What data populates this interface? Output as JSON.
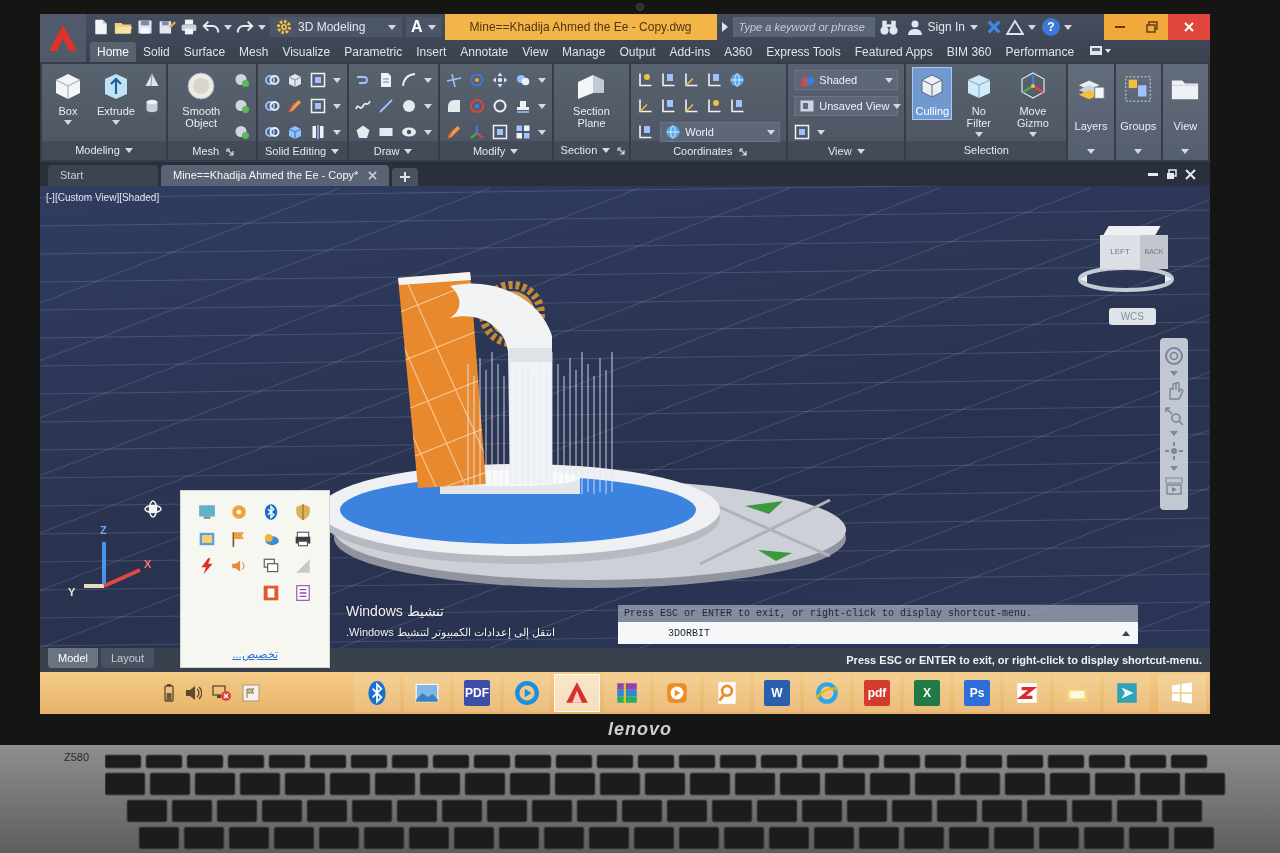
{
  "title_bar": {
    "workspace": "3D Modeling",
    "letter_button": "A",
    "title": "Mine==Khadija Ahmed the Ee - Copy.dwg",
    "search": {
      "placeholder": "Type a keyword or phrase"
    },
    "sign_in": "Sign In",
    "help": "?"
  },
  "ribbon_tabs": [
    {
      "label": "Home",
      "selected": true
    },
    {
      "label": "Solid",
      "selected": false
    },
    {
      "label": "Surface",
      "selected": false
    },
    {
      "label": "Mesh",
      "selected": false
    },
    {
      "label": "Visualize",
      "selected": false
    },
    {
      "label": "Parametric",
      "selected": false
    },
    {
      "label": "Insert",
      "selected": false
    },
    {
      "label": "Annotate",
      "selected": false
    },
    {
      "label": "View",
      "selected": false
    },
    {
      "label": "Manage",
      "selected": false
    },
    {
      "label": "Output",
      "selected": false
    },
    {
      "label": "Add-ins",
      "selected": false
    },
    {
      "label": "A360",
      "selected": false
    },
    {
      "label": "Express Tools",
      "selected": false
    },
    {
      "label": "Featured Apps",
      "selected": false
    },
    {
      "label": "BIM 360",
      "selected": false
    },
    {
      "label": "Performance",
      "selected": false
    }
  ],
  "ribbon_panels": [
    {
      "kind": "modeling",
      "title": "Modeling",
      "buttons": [
        {
          "label": "Box",
          "on": false
        },
        {
          "label": "Extrude",
          "on": false
        }
      ]
    },
    {
      "kind": "mesh",
      "title": "Mesh",
      "buttons": [
        {
          "label": "Smooth Object",
          "on": false
        }
      ]
    },
    {
      "kind": "solidedit",
      "title": "Solid Editing"
    },
    {
      "kind": "draw",
      "title": "Draw"
    },
    {
      "kind": "modify",
      "title": "Modify"
    },
    {
      "kind": "section",
      "title": "Section",
      "buttons": [
        {
          "label": "Section Plane",
          "on": false
        }
      ]
    },
    {
      "kind": "coordinates",
      "title": "Coordinates",
      "dropdowns": [
        "World"
      ]
    },
    {
      "kind": "view",
      "title": "View",
      "dropdowns": [
        "Shaded",
        "Unsaved View"
      ]
    },
    {
      "kind": "selection",
      "title": "Selection",
      "buttons": [
        {
          "label": "Culling",
          "on": true
        },
        {
          "label": "No Filter",
          "on": false
        },
        {
          "label": "Move Gizmo",
          "on": false
        }
      ]
    },
    {
      "kind": "collapsed",
      "title": "Layers"
    },
    {
      "kind": "collapsed",
      "title": "Groups"
    },
    {
      "kind": "collapsed",
      "title": "View"
    }
  ],
  "file_tabs": [
    {
      "label": "Start",
      "selected": false
    },
    {
      "label": "Mine==Khadija Ahmed the Ee - Copy*",
      "selected": true
    }
  ],
  "viewport": {
    "label": "[-][Custom View][Shaded]",
    "viewcube_faces": [
      "LEFT",
      "BACK"
    ],
    "ucs_menu": "WCS",
    "ucs_axes": [
      "Z",
      "Y",
      "X"
    ]
  },
  "command_line": {
    "history": "Press ESC or ENTER to exit, or right-click to display shortcut-menu.",
    "input": "3DORBIT"
  },
  "layout_tabs": [
    {
      "label": "Model",
      "selected": true
    },
    {
      "label": "Layout",
      "selected": false
    }
  ],
  "status_prompt": "Press ESC or ENTER to exit, or right-click to display shortcut-menu.",
  "activation_watermark": {
    "title": "تنشيط Windows",
    "message": "انتقل إلى إعدادات الكمبيوتر لتنشيط Windows."
  },
  "tray_popup": {
    "link": "تخصيص..."
  },
  "taskbar": {
    "apps": [
      {
        "kind": "bluetooth",
        "active": false
      },
      {
        "kind": "photo",
        "active": false
      },
      {
        "kind": "tile",
        "label": "PDF",
        "color": "#3b4fa8",
        "active": false
      },
      {
        "kind": "ring",
        "active": false
      },
      {
        "kind": "triangle",
        "active": true
      },
      {
        "kind": "books",
        "active": false
      },
      {
        "kind": "play",
        "active": false
      },
      {
        "kind": "magnifier",
        "active": false
      },
      {
        "kind": "tile",
        "label": "W",
        "color": "#2b5fae",
        "active": false
      },
      {
        "kind": "browser",
        "active": false
      },
      {
        "kind": "tile",
        "label": "pdf",
        "color": "#d33b2c",
        "active": false
      },
      {
        "kind": "tile",
        "label": "X",
        "color": "#1f7a46",
        "active": false
      },
      {
        "kind": "tile",
        "label": "Ps",
        "color": "#2d6fd6",
        "active": false
      },
      {
        "kind": "zigzag",
        "active": false
      },
      {
        "kind": "folder",
        "active": false
      },
      {
        "kind": "arrow",
        "active": false
      }
    ]
  },
  "laptop": {
    "brand": "lenovo",
    "model": "Z580"
  }
}
